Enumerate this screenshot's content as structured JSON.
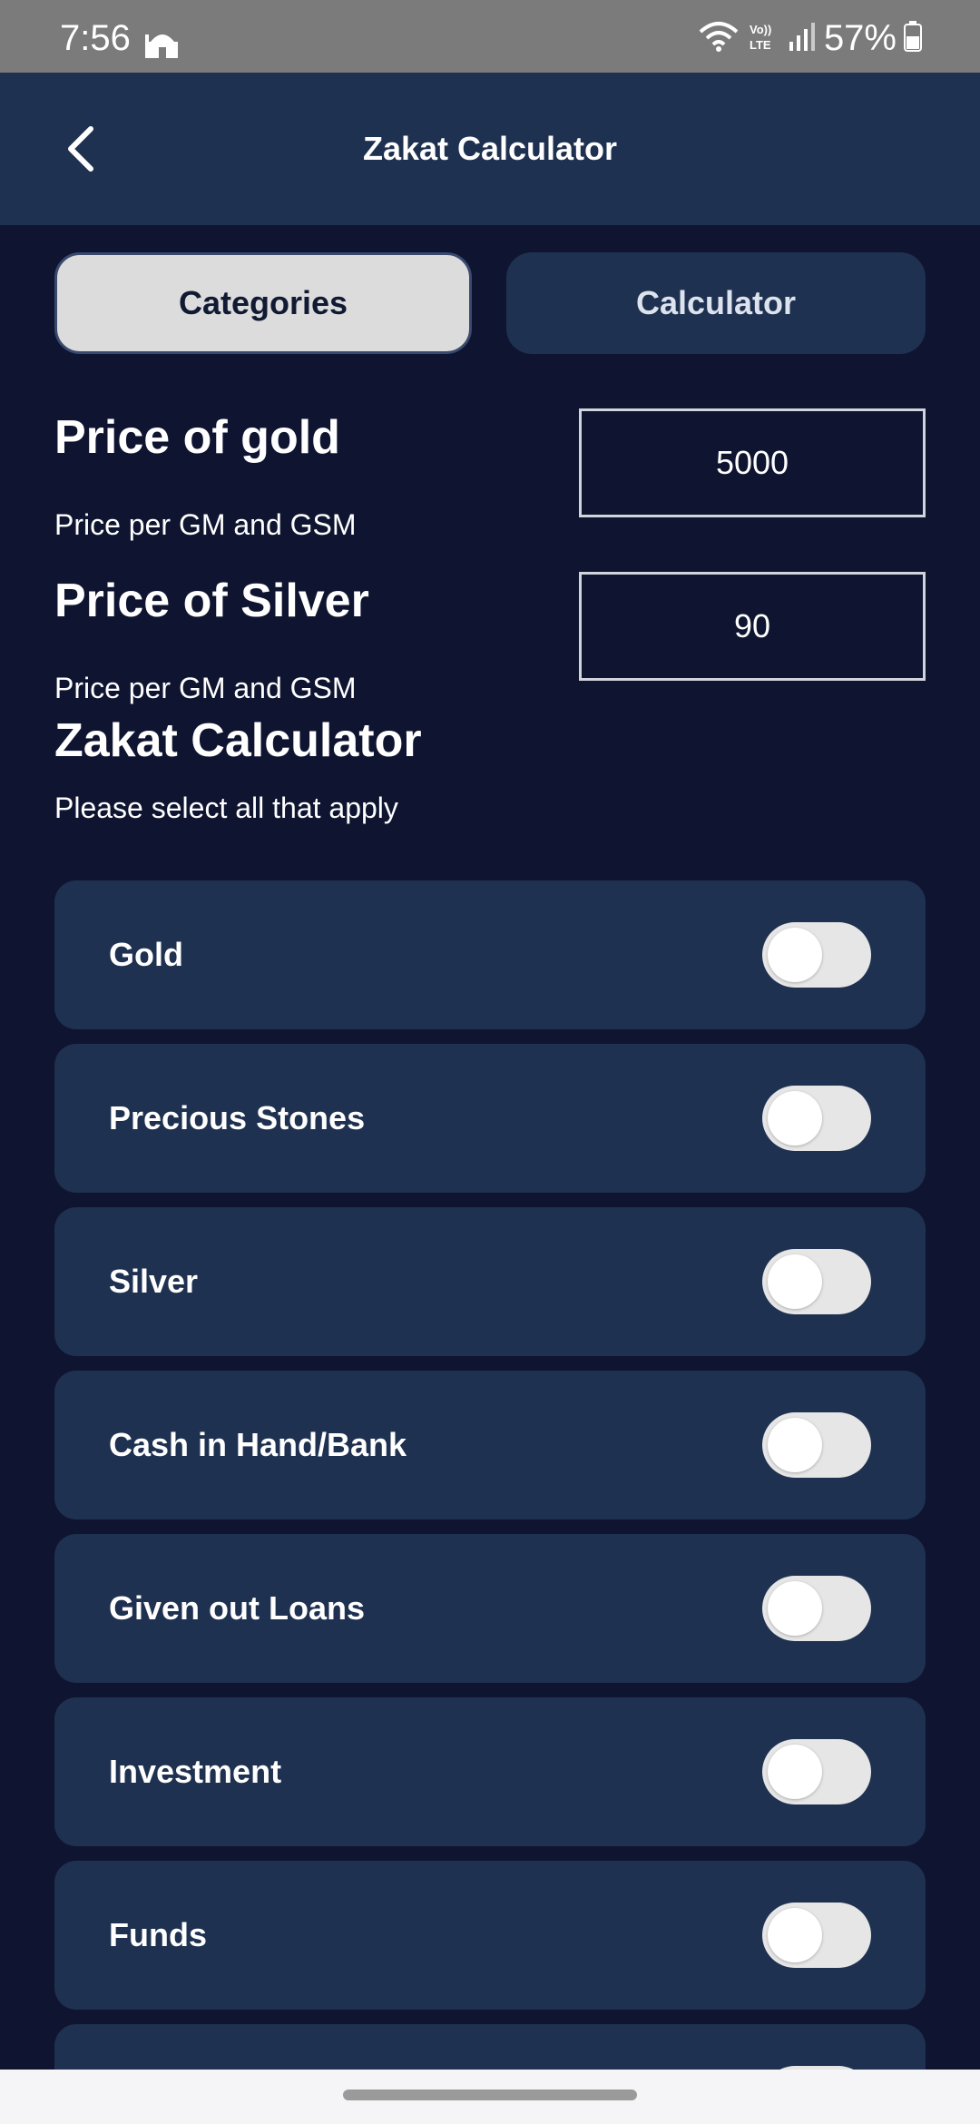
{
  "status_bar": {
    "time": "7:56",
    "battery": "57%",
    "icons": [
      "mosque-icon",
      "wifi-icon",
      "volte-icon",
      "signal-icon",
      "battery-icon"
    ]
  },
  "app_bar": {
    "title": "Zakat Calculator",
    "back_icon": "back-arrow-icon"
  },
  "tabs": [
    {
      "label": "Categories",
      "selected": true
    },
    {
      "label": "Calculator",
      "selected": false
    }
  ],
  "gold": {
    "title": "Price of gold",
    "subtitle": "Price per GM and GSM",
    "value": "5000"
  },
  "silver": {
    "title": "Price of Silver",
    "subtitle": "Price per GM and GSM",
    "value": "90"
  },
  "section": {
    "title": "Zakat Calculator",
    "subtitle": "Please select all that apply"
  },
  "categories": [
    {
      "label": "Gold",
      "enabled": false
    },
    {
      "label": "Precious Stones",
      "enabled": false
    },
    {
      "label": "Silver",
      "enabled": false
    },
    {
      "label": "Cash in Hand/Bank",
      "enabled": false
    },
    {
      "label": "Given out Loans",
      "enabled": false
    },
    {
      "label": "Investment",
      "enabled": false
    },
    {
      "label": "Funds",
      "enabled": false
    }
  ],
  "colors": {
    "background": "#0f1530",
    "card": "#1f3150",
    "selected_tab": "#dcdcdc",
    "toggle_off": "#e6e6e6"
  }
}
